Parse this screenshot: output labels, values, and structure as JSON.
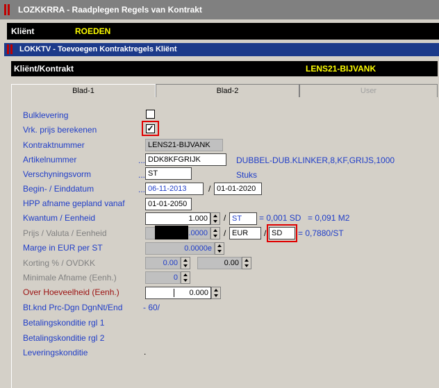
{
  "window": {
    "title": "LOZKKRRA - Raadplegen Regels van Kontrakt"
  },
  "client": {
    "label": "Kliënt",
    "value": "ROEDEN"
  },
  "subwindow": {
    "title": "LOKKTV - Toevoegen Kontraktregels Kliënt"
  },
  "contract_bar": {
    "label": "Kliënt/Kontrakt",
    "value": "LENS21-BIJVANK"
  },
  "tabs": [
    "Blad-1",
    "Blad-2",
    "User"
  ],
  "form": {
    "bulklevering_label": "Bulklevering",
    "vrk_label": "Vrk. prijs berekenen",
    "kontraktnummer_label": "Kontraktnummer",
    "kontraktnummer_value": "LENS21-BIJVANK",
    "artikel_label": "Artikelnummer",
    "artikel_value": "DDK8KFGRIJK",
    "artikel_desc": "DUBBEL-DUB.KLINKER,8,KF,GRIJS,1000",
    "verschijning_label": "Verschyningsvorm",
    "verschijning_value": "ST",
    "verschijning_desc": "Stuks",
    "datum_label": "Begin- / Einddatum",
    "begin_value": "06-11-2013",
    "eind_value": "01-01-2020",
    "hpp_label": "HPP afname gepland vanaf",
    "hpp_value": "01-01-2050",
    "kwantum_label": "Kwantum / Eenheid",
    "kwantum_value": "1.000",
    "kwantum_unit": "ST",
    "kwantum_conv": "= 0,001 SD",
    "kwantum_conv2": "= 0,091 M2",
    "prijs_label": "Prijs / Valuta / Eenheid",
    "prijs_value": ".0000",
    "valuta_value": "EUR",
    "prijs_unit": "SD",
    "prijs_conv": "= 0,7880/ST",
    "marge_label": "Marge in EUR per ST",
    "marge_value": "0.0000e",
    "korting_label": "Korting % / OVDKK",
    "korting_value": "0.00",
    "ovdkk_value": "0.00",
    "min_label": "Minimale Afname (Eenh.)",
    "min_value": "0",
    "over_label": "Over Hoeveelheid (Eenh.)",
    "over_value": "0.000",
    "btknd_label": "Bt.knd Prc-Dgn DgnNt/End",
    "btknd_value": "- 60/",
    "bet1_label": "Betalingskonditie rgl 1",
    "bet2_label": "Betalingskonditie rgl 2",
    "lev_label": "Leveringskonditie",
    "lev_value": ".",
    "sep_slash": "/",
    "dots": "...",
    "check_mark": "✓"
  }
}
